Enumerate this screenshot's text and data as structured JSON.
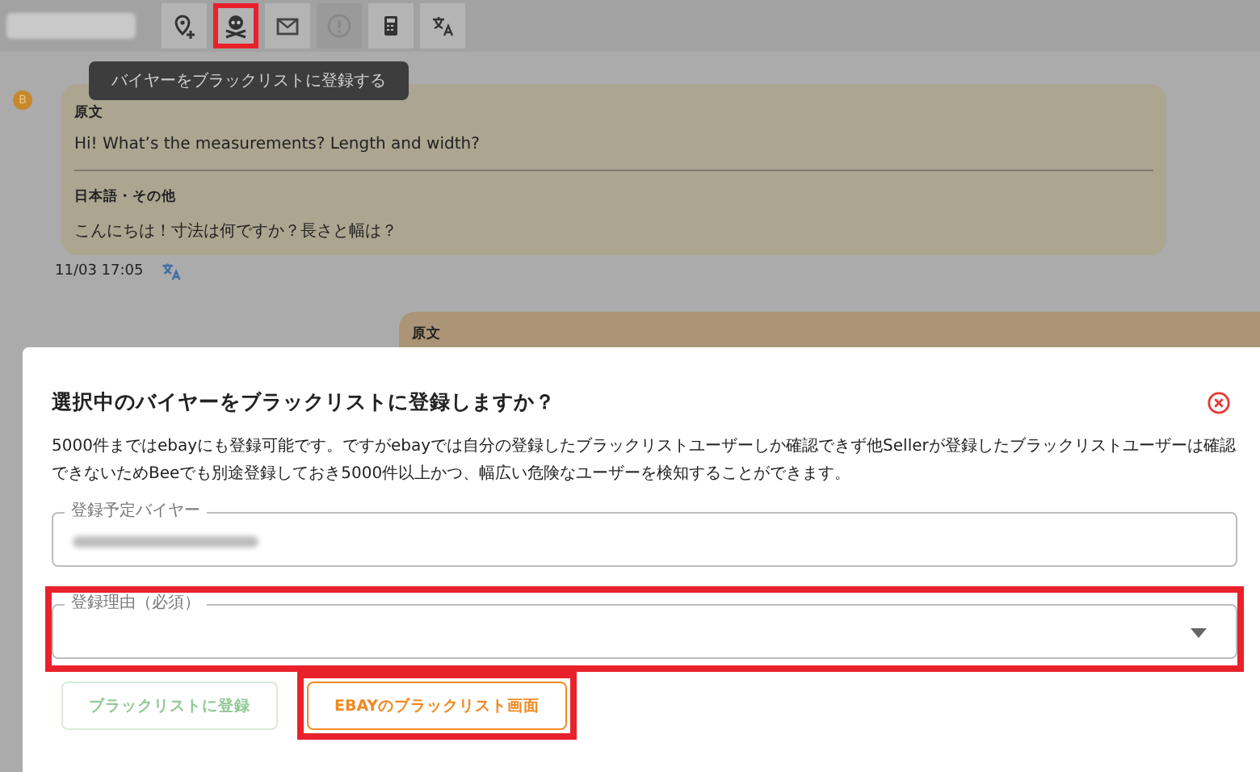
{
  "toolbar": {
    "buttons": [
      {
        "kind": "pin-plus",
        "highlighted": false,
        "disabled": false
      },
      {
        "kind": "skull",
        "highlighted": true,
        "disabled": false
      },
      {
        "kind": "mail",
        "highlighted": false,
        "disabled": false
      },
      {
        "kind": "alert",
        "highlighted": false,
        "disabled": true
      },
      {
        "kind": "calculator",
        "highlighted": false,
        "disabled": false
      },
      {
        "kind": "translate",
        "highlighted": false,
        "disabled": false
      }
    ],
    "tooltip": "バイヤーをブラックリストに登録する"
  },
  "messages": [
    {
      "kind": "incoming",
      "avatar": "B",
      "original_label": "原文",
      "original_text": "Hi! What’s the measurements? Length and width?",
      "translation_label": "日本語・その他",
      "translation_text": "こんにちは！寸法は何ですか？長さと幅は？",
      "time": "11/03 17:05"
    },
    {
      "kind": "outgoing",
      "original_label": "原文"
    }
  ],
  "dialog": {
    "title": "選択中のバイヤーをブラックリストに登録しますか？",
    "description": "5000件まではebayにも登録可能です。ですがebayでは自分の登録したブラックリストユーザーしか確認できず他Sellerが登録したブラックリストユーザーは確認できないためBeeでも別途登録しておき5000件以上かつ、幅広い危険なユーザーを検知することができます。",
    "fields": [
      {
        "kind": "text",
        "label": "登録予定バイヤー",
        "highlighted": false
      },
      {
        "kind": "select",
        "label": "登録理由（必須）",
        "highlighted": true
      }
    ],
    "buttons": [
      {
        "label": "ブラックリストに登録",
        "kind": "primary",
        "disabled": true,
        "highlighted": false
      },
      {
        "label": "EBAYのブラックリスト画面",
        "kind": "secondary",
        "disabled": false,
        "highlighted": true
      }
    ]
  }
}
